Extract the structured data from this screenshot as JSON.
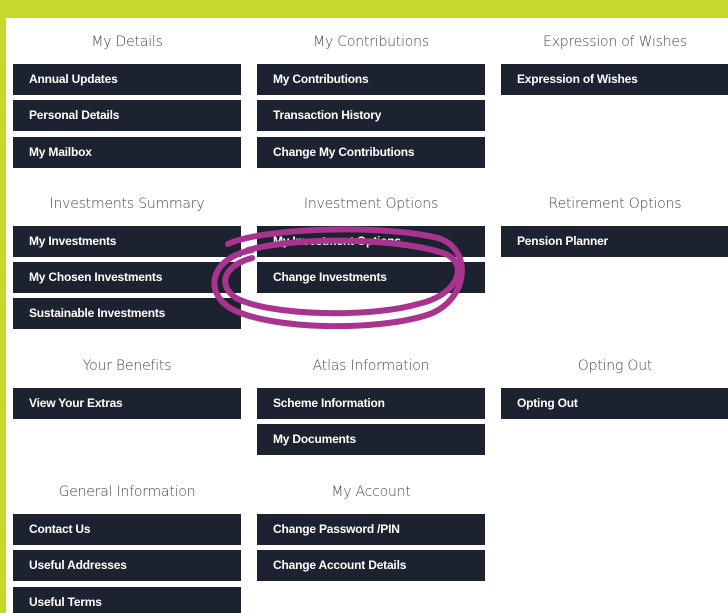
{
  "sections": {
    "my_details": {
      "title": "My Details",
      "items": [
        "Annual Updates",
        "Personal Details",
        "My Mailbox"
      ]
    },
    "my_contributions": {
      "title": "My Contributions",
      "items": [
        "My Contributions",
        "Transaction History",
        "Change My Contributions"
      ]
    },
    "expression_of_wishes": {
      "title": "Expression of Wishes",
      "items": [
        "Expression of Wishes"
      ]
    },
    "investments_summary": {
      "title": "Investments Summary",
      "items": [
        "My Investments",
        "My Chosen Investments",
        "Sustainable Investments"
      ]
    },
    "investment_options": {
      "title": "Investment Options",
      "items": [
        "My Investment Options",
        "Change Investments"
      ]
    },
    "retirement_options": {
      "title": "Retirement Options",
      "items": [
        "Pension Planner"
      ]
    },
    "your_benefits": {
      "title": "Your Benefits",
      "items": [
        "View Your Extras"
      ]
    },
    "atlas_information": {
      "title": "Atlas Information",
      "items": [
        "Scheme Information",
        "My Documents"
      ]
    },
    "opting_out": {
      "title": "Opting Out",
      "items": [
        "Opting Out"
      ]
    },
    "general_information": {
      "title": "General Information",
      "items": [
        "Contact Us",
        "Useful Addresses",
        "Useful Terms"
      ]
    },
    "my_account": {
      "title": "My Account",
      "items": [
        "Change Password /PIN",
        "Change Account Details"
      ]
    }
  },
  "colors": {
    "frame": "#c6d82c",
    "button_bg": "#1c2230",
    "button_text": "#ffffff",
    "heading_text": "#4a4a4a",
    "annotation": "#a8348f"
  }
}
